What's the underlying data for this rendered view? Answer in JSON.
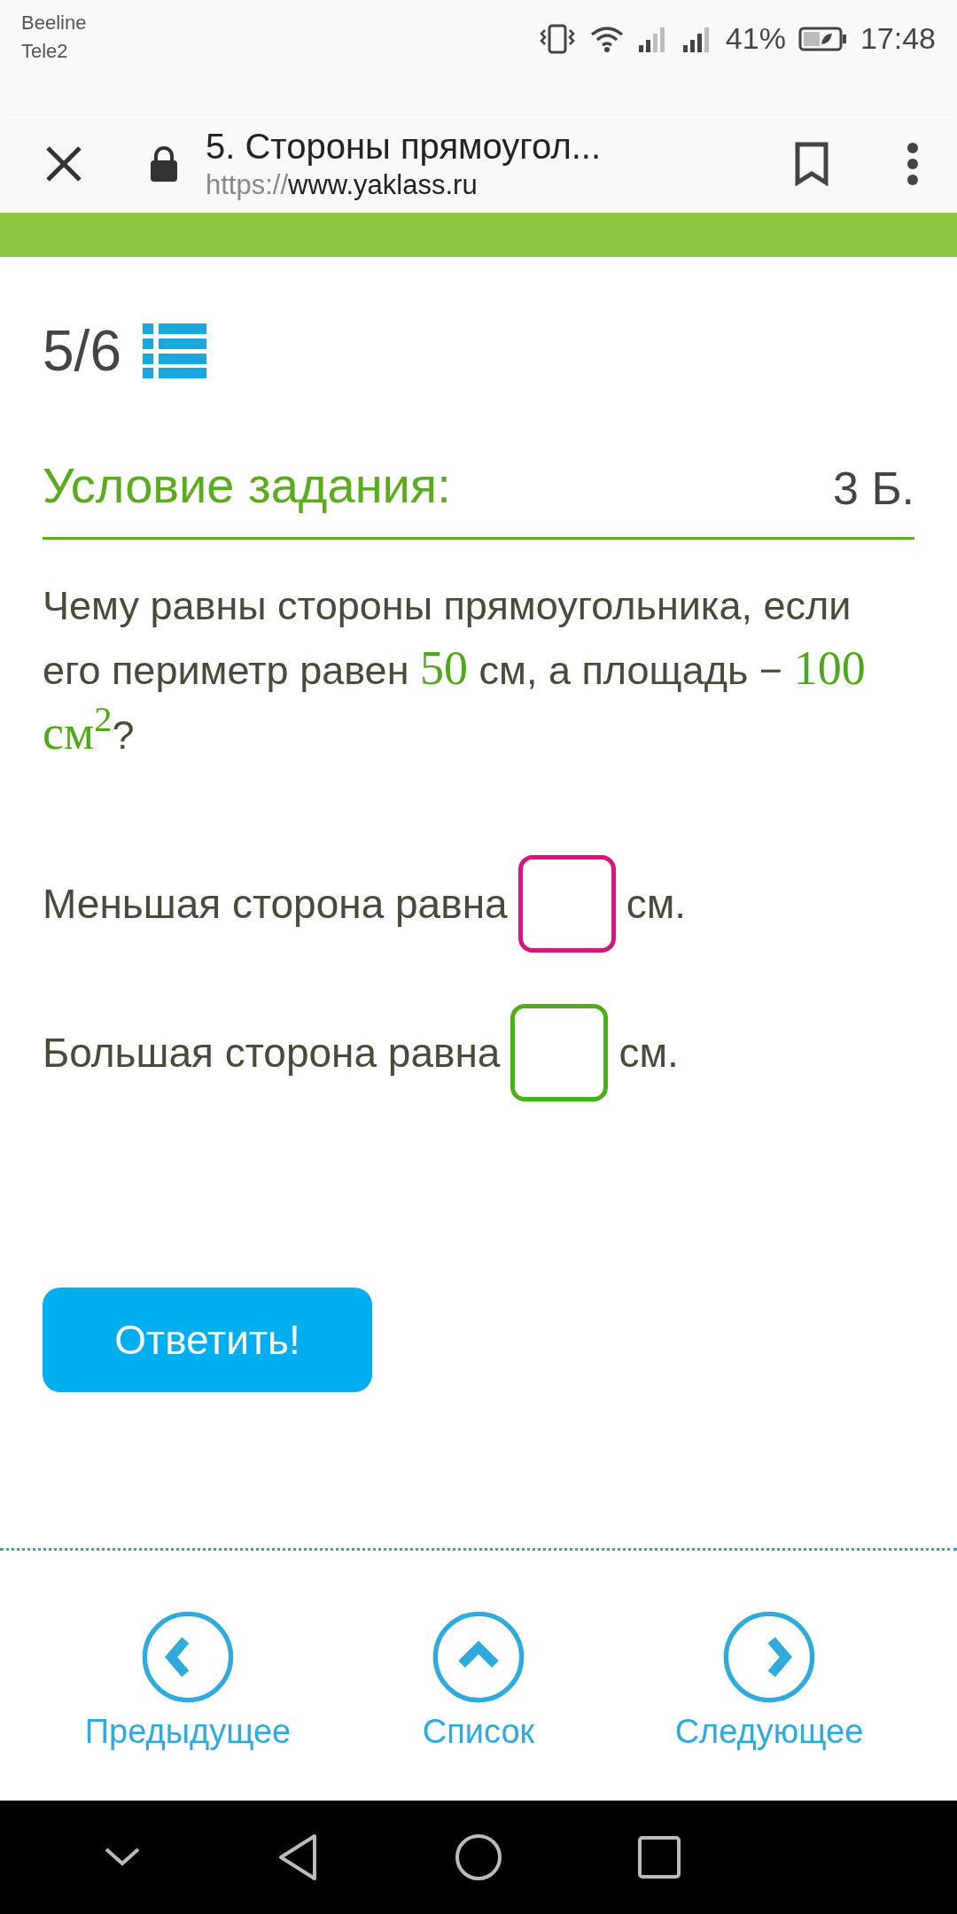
{
  "status_bar": {
    "carriers": [
      "Beeline",
      "Tele2"
    ],
    "battery": "41%",
    "time": "17:48"
  },
  "browser": {
    "page_title": "5. Стороны прямоугол...",
    "url_scheme": "https://",
    "url_host": "www.yaklass.ru"
  },
  "progress": {
    "counter": "5/6"
  },
  "task": {
    "heading": "Условие задания:",
    "points": "3 Б.",
    "question": [
      {
        "kind": "text",
        "text": "Чему равны стороны прямоугольника, если его периметр равен "
      },
      {
        "kind": "math",
        "text": "50"
      },
      {
        "kind": "text",
        "text": " см, а площадь − "
      },
      {
        "kind": "math",
        "text": "100 см$^{2}$"
      },
      {
        "kind": "text",
        "text": "?"
      }
    ],
    "answers": [
      {
        "label": "Меньшая сторона равна",
        "unit": "см.",
        "color": "#d6157e"
      },
      {
        "label": "Большая сторона равна",
        "unit": "см.",
        "color": "#4caf1a"
      }
    ],
    "submit": "Ответить!"
  },
  "nav": [
    {
      "kind": "prev",
      "label": "Предыдущее"
    },
    {
      "kind": "list",
      "label": "Список"
    },
    {
      "kind": "next",
      "label": "Следующее"
    }
  ]
}
